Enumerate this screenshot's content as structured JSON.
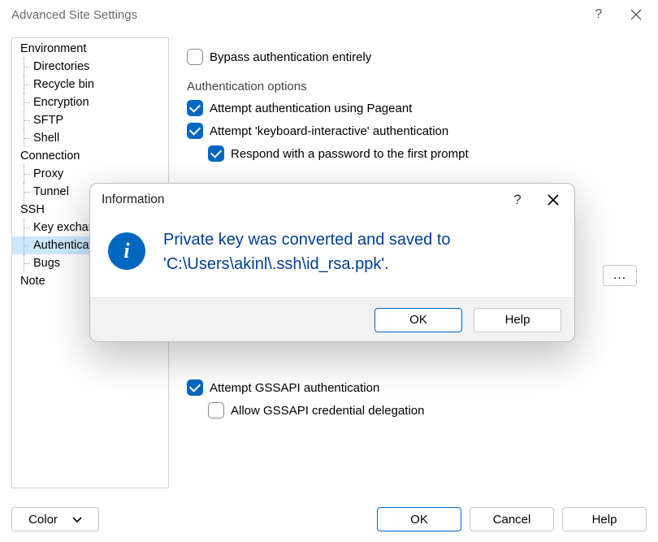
{
  "title": "Advanced Site Settings",
  "tree": {
    "env": "Environment",
    "directories": "Directories",
    "recycle": "Recycle bin",
    "encryption": "Encryption",
    "sftp": "SFTP",
    "shell": "Shell",
    "connection": "Connection",
    "proxy": "Proxy",
    "tunnel": "Tunnel",
    "ssh": "SSH",
    "keyex": "Key exchange",
    "auth": "Authentication",
    "bugs": "Bugs",
    "note": "Note"
  },
  "auth": {
    "bypass": "Bypass authentication entirely",
    "options_label": "Authentication options",
    "pageant": "Attempt authentication using Pageant",
    "kbi": "Attempt 'keyboard-interactive' authentication",
    "respond": "Respond with a password to the first prompt",
    "gssapi": "Attempt GSSAPI authentication",
    "gssdeleg": "Allow GSSAPI credential delegation",
    "browse": "..."
  },
  "footer": {
    "color": "Color",
    "ok": "OK",
    "cancel": "Cancel",
    "help": "Help"
  },
  "modal": {
    "title": "Information",
    "msg1": "Private key was converted and saved to",
    "msg2": "'C:\\Users\\akinl\\.ssh\\id_rsa.ppk'.",
    "ok": "OK",
    "help": "Help"
  }
}
